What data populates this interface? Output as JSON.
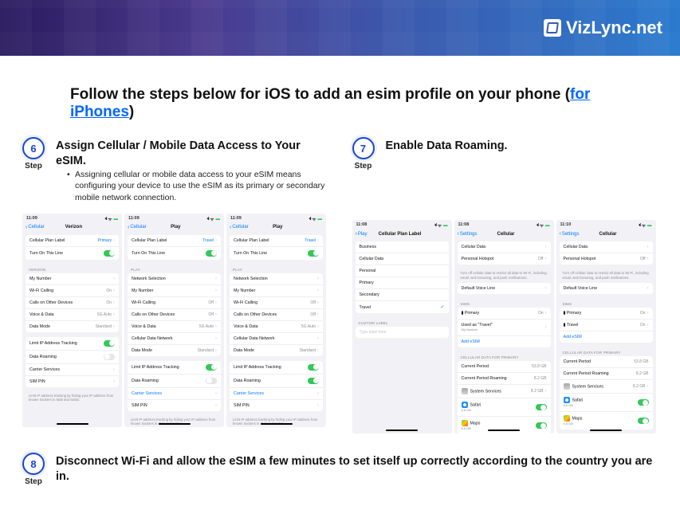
{
  "brand": "VizLync.net",
  "title_prefix": "Follow the steps below for iOS to add an esim profile on your phone (",
  "title_link": "for iPhones",
  "title_suffix": ")",
  "step6": {
    "num": "6",
    "label": "Step",
    "title": "Assign Cellular / Mobile Data Access to Your eSIM.",
    "desc": "Assigning cellular or mobile data access to your eSIM means configuring your device to use the eSIM as its primary or secondary mobile network connection."
  },
  "step7": {
    "num": "7",
    "label": "Step",
    "title": "Enable Data Roaming."
  },
  "step8": {
    "num": "8",
    "label": "Step",
    "title": "Disconnect Wi-Fi and allow the eSIM a few minutes to set itself up correctly according to the country you are in."
  },
  "s6a": {
    "time": "11:09",
    "back": "Cellular",
    "title": "Verizon",
    "r1l": "Cellular Plan Label",
    "r1v": "Primary",
    "r2l": "Turn On This Line",
    "gh1": "VERIZON",
    "r3l": "My Number",
    "r3v": "",
    "r4l": "Wi-Fi Calling",
    "r4v": "On",
    "r5l": "Calls on Other Devices",
    "r5v": "On",
    "r6l": "Voice & Data",
    "r6v": "5G Auto",
    "r7l": "Data Mode",
    "r7v": "Standard",
    "r8l": "Limit IP Address Tracking",
    "r9l": "Data Roaming",
    "r10l": "Carrier Services",
    "r11l": "SIM PIN",
    "foot": "Limit IP address tracking by hiding your IP address from known trackers in Mail and Safari."
  },
  "s6b": {
    "time": "11:09",
    "back": "Cellular",
    "title": "Play",
    "r1l": "Cellular Plan Label",
    "r1v": "Travel",
    "r2l": "Turn On This Line",
    "gh1": "PLAY",
    "r3l": "Network Selection",
    "r4l": "My Number",
    "r5l": "Wi-Fi Calling",
    "r5v": "Off",
    "r6l": "Calls on Other Devices",
    "r6v": "Off",
    "r7l": "Voice & Data",
    "r7v": "5G Auto",
    "r8l": "Cellular Data Network",
    "r9l": "Data Mode",
    "r9v": "Standard",
    "r10l": "Limit IP Address Tracking",
    "r11l": "Data Roaming",
    "r12l": "Carrier Services",
    "r13l": "SIM PIN",
    "foot": "Limit IP address tracking by hiding your IP address from known trackers in Mail and Safari."
  },
  "s6c": {
    "time": "11:09",
    "back": "Cellular",
    "title": "Play",
    "r1l": "Cellular Plan Label",
    "r1v": "Travel",
    "r2l": "Turn On This Line",
    "gh1": "PLAY",
    "r3l": "Network Selection",
    "r4l": "My Number",
    "r5l": "Wi-Fi Calling",
    "r5v": "Off",
    "r6l": "Calls on Other Devices",
    "r6v": "Off",
    "r7l": "Voice & Data",
    "r7v": "5G Auto",
    "r8l": "Cellular Data Network",
    "r9l": "Data Mode",
    "r9v": "Standard",
    "r10l": "Limit IP Address Tracking",
    "r11l": "Data Roaming",
    "r12l": "Carrier Services",
    "r13l": "SIM PIN",
    "foot": "Limit IP address tracking by hiding your IP address from known trackers in Mail and Safari."
  },
  "s7a": {
    "time": "11:08",
    "back": "Play",
    "title": "Cellular Plan Label",
    "r1": "Business",
    "r2": "Cellular Data",
    "r3": "Personal",
    "r4": "Primary",
    "r5": "Secondary",
    "r6": "Travel",
    "gh": "CUSTOM LABEL",
    "placeholder": "Type label here"
  },
  "s7b": {
    "time": "11:08",
    "back": "Settings",
    "title": "Cellular",
    "r1l": "Cellular Data",
    "r2l": "Personal Hotspot",
    "r2v": "Off",
    "foot1": "Turn off cellular data to restrict all data to Wi-Fi, including email, web browsing, and push notifications.",
    "r3l": "Default Voice Line",
    "gh1": "SIMS",
    "r4l": "Primary",
    "r4v": "On",
    "r4s": "",
    "r5l": "Used as \"Travel\"",
    "r5s": "My Number",
    "r6l": "Add eSIM",
    "gh2": "CELLULAR DATA FOR PRIMARY",
    "r7l": "Current Period",
    "r7v": "53.8 GB",
    "r8l": "Current Period Roaming",
    "r8v": "8.2 GB",
    "r9l": "System Services",
    "r9v": "8.2 GB",
    "r10l": "Safari",
    "r10s": "5.6 GB",
    "r11l": "Maps",
    "r11s": "5.6 GB"
  },
  "s7c": {
    "time": "11:10",
    "back": "Settings",
    "title": "Cellular",
    "r1l": "Cellular Data",
    "r2l": "Personal Hotspot",
    "r2v": "Off",
    "foot1": "Turn off cellular data to restrict all data to Wi-Fi, including email, web browsing, and push notifications.",
    "r3l": "Default Voice Line",
    "gh1": "SIMS",
    "r4l": "Primary",
    "r4v": "On",
    "r4s": "",
    "r5l": "Travel",
    "r5v": "On",
    "r5s": "",
    "r6l": "Add eSIM",
    "gh2": "CELLULAR DATA FOR PRIMARY",
    "r7l": "Current Period",
    "r7v": "53.8 GB",
    "r8l": "Current Period Roaming",
    "r8v": "8.2 GB",
    "r9l": "System Services",
    "r9v": "8.2 GB",
    "r10l": "Safari",
    "r10s": "5.6 GB",
    "r11l": "Maps",
    "r11s": "5.6 GB"
  },
  "sim_prefix": "▮ "
}
